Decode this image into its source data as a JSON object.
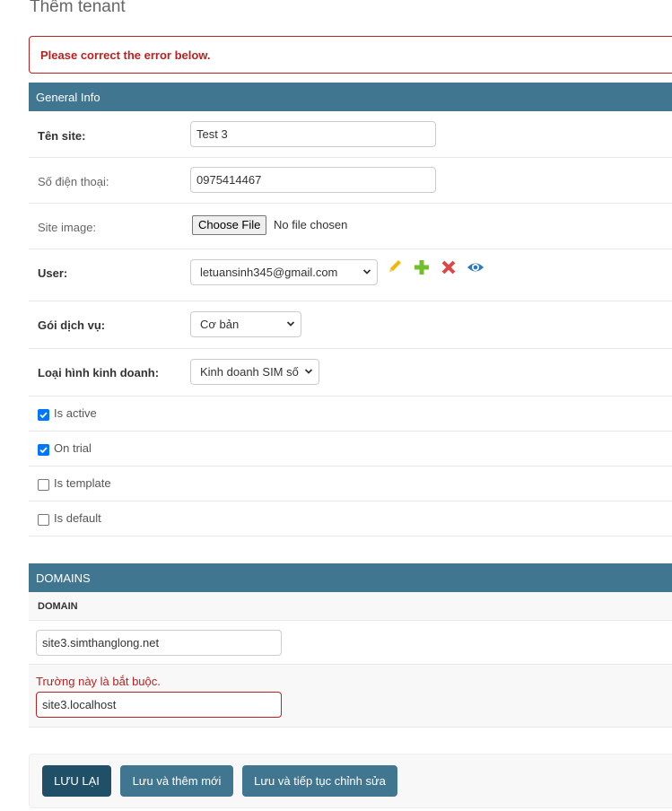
{
  "page": {
    "title": "Thêm tenant"
  },
  "errornote": "Please correct the error below.",
  "general": {
    "header": "General Info",
    "site_name": {
      "label": "Tên site:",
      "value": "Test 3"
    },
    "phone": {
      "label": "Số điện thoại:",
      "value": "0975414467"
    },
    "site_image": {
      "label": "Site image:",
      "button": "Choose File",
      "status": "No file chosen"
    },
    "user": {
      "label": "User:",
      "selected": "letuansinh345@gmail.com",
      "icons": [
        "pencil-icon",
        "plus-icon",
        "delete-x-icon",
        "eye-icon"
      ]
    },
    "plan": {
      "label": "Gói dịch vụ:",
      "selected": "Cơ bản"
    },
    "business_type": {
      "label": "Loại hình kinh doanh:",
      "selected": "Kinh doanh SIM số"
    },
    "checkboxes": [
      {
        "label": "Is active",
        "checked": true
      },
      {
        "label": "On trial",
        "checked": true
      },
      {
        "label": "Is template",
        "checked": false
      },
      {
        "label": "Is default",
        "checked": false
      }
    ]
  },
  "domains": {
    "header": "DOMAINS",
    "column": "DOMAIN",
    "rows": [
      {
        "value": "site3.simthanglong.net",
        "error": ""
      },
      {
        "value": "site3.localhost",
        "error": "Trường này là bắt buộc."
      }
    ]
  },
  "colors": {
    "accent": "#417690",
    "primary": "#205067",
    "error": "#ba2121",
    "checkbox": "#0075ff"
  },
  "actions": {
    "save": "LƯU LẠI",
    "save_add": "Lưu và thêm mới",
    "save_continue": "Lưu và tiếp tục chỉnh sửa"
  }
}
